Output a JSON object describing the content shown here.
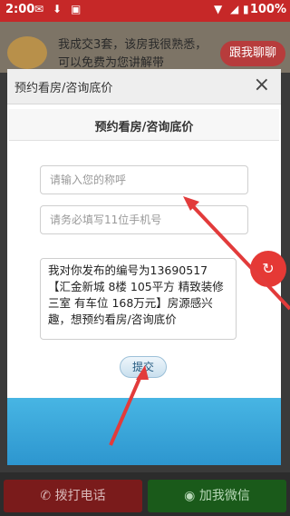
{
  "status_bar": {
    "time": "2:00",
    "battery": "100%"
  },
  "background": {
    "message": "我成交3套，该房我很熟悉，可以免费为您讲解带",
    "follow_button": "跟我聊聊",
    "call_button": "拨打电话",
    "wechat_button": "加我微信"
  },
  "dialog": {
    "title": "预约看房/咨询底价",
    "close_label": "×",
    "inner_title": "预约看房/咨询底价",
    "name_placeholder": "请输入您的称呼",
    "phone_placeholder": "请务必填写11位手机号",
    "message": "我对你发布的编号为13690517【汇金新城  8楼  105平方  精致装修  三室  有车位  168万元】房源感兴趣，想预约看房/咨询底价",
    "submit_label": "提交"
  },
  "colors": {
    "accent_red": "#c62828",
    "submit_blue": "#c9dfee",
    "arrow": "#e23b3b"
  }
}
